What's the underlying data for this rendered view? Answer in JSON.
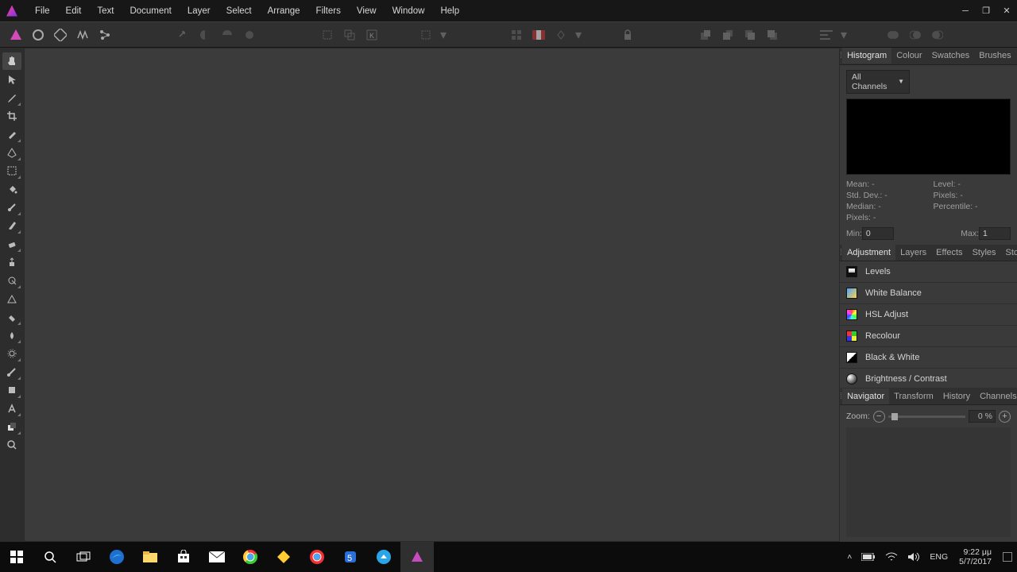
{
  "menu": {
    "items": [
      "File",
      "Edit",
      "Text",
      "Document",
      "Layer",
      "Select",
      "Arrange",
      "Filters",
      "View",
      "Window",
      "Help"
    ]
  },
  "panels": {
    "top_tabs": {
      "items": [
        "Histogram",
        "Colour",
        "Swatches",
        "Brushes"
      ],
      "active": 0
    },
    "histogram": {
      "channel_dd": "All Channels",
      "stats": {
        "mean": "Mean: -",
        "std": "Std. Dev.: -",
        "median": "Median: -",
        "pixels": "Pixels: -",
        "level": "Level: -",
        "pixels2": "Pixels: -",
        "percentile": "Percentile: -"
      },
      "min_label": "Min:",
      "min_val": "0",
      "max_label": "Max:",
      "max_val": "1"
    },
    "mid_tabs": {
      "items": [
        "Adjustment",
        "Layers",
        "Effects",
        "Styles",
        "Stock"
      ],
      "active": 0
    },
    "adjustments": [
      {
        "label": "Levels",
        "iconClass": "ic-levels"
      },
      {
        "label": "White Balance",
        "iconClass": "ic-wb"
      },
      {
        "label": "HSL Adjust",
        "iconClass": "ic-hsl"
      },
      {
        "label": "Recolour",
        "iconClass": "ic-rec"
      },
      {
        "label": "Black & White",
        "iconClass": "ic-bw"
      },
      {
        "label": "Brightness / Contrast",
        "iconClass": "ic-bc"
      }
    ],
    "bot_tabs": {
      "items": [
        "Navigator",
        "Transform",
        "History",
        "Channels"
      ],
      "active": 0
    },
    "navigator": {
      "zoom_label": "Zoom:",
      "zoom_value": "0 %"
    }
  },
  "taskbar": {
    "lang": "ENG",
    "time": "9:22 μμ",
    "date": "5/7/2017"
  }
}
